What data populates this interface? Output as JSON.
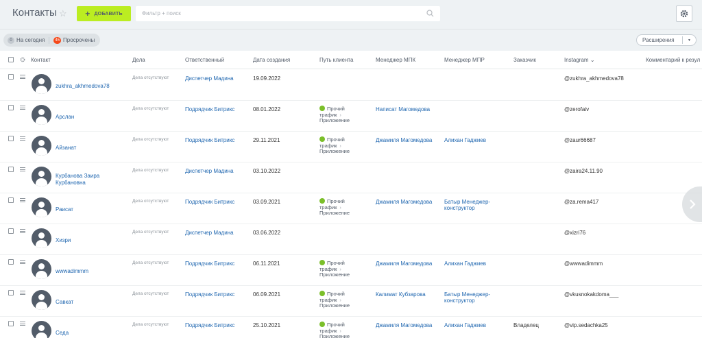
{
  "header": {
    "title": "Контакты",
    "add_label": "ДОБАВИТЬ",
    "search_placeholder": "Фильтр + поиск"
  },
  "counters": {
    "today_count": "0",
    "today_label": "На сегодня",
    "overdue_count": "45",
    "overdue_label": "Просрочены"
  },
  "extensions_label": "Расширения",
  "columns": {
    "contact": "Контакт",
    "deals": "Дела",
    "responsible": "Ответственный",
    "created": "Дата создания",
    "path": "Путь клиента",
    "mpk": "Менеджер МПК",
    "mpr": "Менеджер МПР",
    "customer": "Заказчик",
    "instagram": "Instagram",
    "comment": "Комментарий к резул"
  },
  "rows": [
    {
      "name": "zukhra_akhmedova78",
      "deals": "Дела отсутствуют",
      "responsible": "Диспетчер Мадина",
      "created": "19.09.2022",
      "path1": "",
      "path2": "",
      "path3": "",
      "mpk": "",
      "mpr": "",
      "customer": "",
      "instagram": "@zukhra_akhmedova78"
    },
    {
      "name": "Арслан",
      "deals": "Дела отсутствуют",
      "responsible": "Подрядчик Битрикс",
      "created": "08.01.2022",
      "path1": "Прочий",
      "path2": "трафик",
      "path3": "Приложение",
      "mpk": "Написат Магомедова",
      "mpr": "",
      "customer": "",
      "instagram": "@zerofaiv"
    },
    {
      "name": "Айзанат",
      "deals": "Дела отсутствуют",
      "responsible": "Подрядчик Битрикс",
      "created": "29.11.2021",
      "path1": "Прочий",
      "path2": "трафик",
      "path3": "Приложение",
      "mpk": "Джамиля Магомедова",
      "mpr": "Алихан Гаджиев",
      "customer": "",
      "instagram": "@zaur66687"
    },
    {
      "name": "Курбанова Заира Курбановна",
      "deals": "Дела отсутствуют",
      "responsible": "Диспетчер Мадина",
      "created": "03.10.2022",
      "path1": "",
      "path2": "",
      "path3": "",
      "mpk": "",
      "mpr": "",
      "customer": "",
      "instagram": "@zaira24.11.90"
    },
    {
      "name": "Раисат",
      "deals": "Дела отсутствуют",
      "responsible": "Подрядчик Битрикс",
      "created": "03.09.2021",
      "path1": "Прочий",
      "path2": "трафик",
      "path3": "Приложение",
      "mpk": "Джамиля Магомедова",
      "mpr": "Батыр Менеджер-конструктор",
      "customer": "",
      "instagram": "@za.rema417"
    },
    {
      "name": "Хизри",
      "deals": "Дела отсутствуют",
      "responsible": "Диспетчер Мадина",
      "created": "03.06.2022",
      "path1": "",
      "path2": "",
      "path3": "",
      "mpk": "",
      "mpr": "",
      "customer": "",
      "instagram": "@xizri76"
    },
    {
      "name": "wwwadimmm",
      "deals": "Дела отсутствуют",
      "responsible": "Подрядчик Битрикс",
      "created": "06.11.2021",
      "path1": "Прочий",
      "path2": "трафик",
      "path3": "Приложение",
      "mpk": "Джамиля Магомедова",
      "mpr": "Алихан Гаджиев",
      "customer": "",
      "instagram": "@wwwadimmm"
    },
    {
      "name": "Савкат",
      "deals": "Дела отсутствуют",
      "responsible": "Подрядчик Битрикс",
      "created": "06.09.2021",
      "path1": "Прочий",
      "path2": "трафик",
      "path3": "Приложение",
      "mpk": "Калимат Кубзарова",
      "mpr": "Батыр Менеджер-конструктор",
      "customer": "",
      "instagram": "@vkusnokakdoma___"
    },
    {
      "name": "Седа",
      "deals": "Дела отсутствуют",
      "responsible": "Подрядчик Битрикс",
      "created": "25.10.2021",
      "path1": "Прочий",
      "path2": "трафик",
      "path3": "Приложение",
      "mpk": "Джамиля Магомедова",
      "mpr": "Алихан Гаджиев",
      "customer": "Владелец",
      "instagram": "@vip.sedachka25"
    }
  ]
}
